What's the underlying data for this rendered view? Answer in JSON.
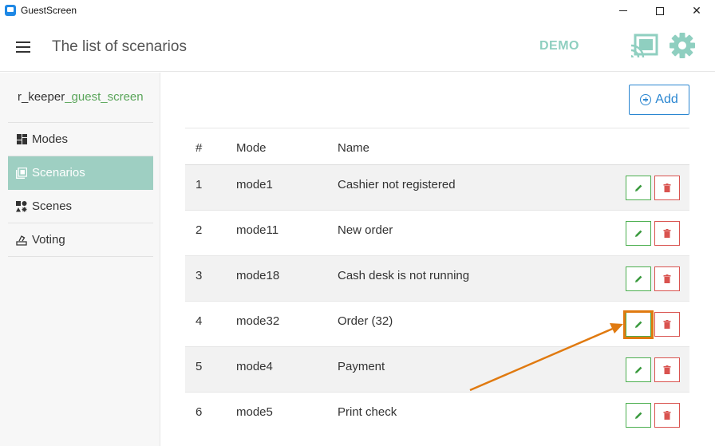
{
  "window": {
    "title": "GuestScreen",
    "minimize": "minimize",
    "maximize": "maximize",
    "close": "✕"
  },
  "header": {
    "page_title": "The list of scenarios",
    "demo_label": "DEMO",
    "icons": {
      "menu": "hamburger-icon",
      "cast": "cast-icon",
      "settings": "gear-icon"
    },
    "accent_color": "#8fcfc0"
  },
  "sidebar": {
    "brand_prefix": "r_keeper",
    "brand_suffix": "_guest_screen",
    "items": [
      {
        "label": "Modes",
        "icon": "dashboard-icon",
        "active": false
      },
      {
        "label": "Scenarios",
        "icon": "scenarios-icon",
        "active": true
      },
      {
        "label": "Scenes",
        "icon": "scenes-icon",
        "active": false
      },
      {
        "label": "Voting",
        "icon": "voting-icon",
        "active": false
      }
    ],
    "active_color": "#9ecfc2"
  },
  "toolbar": {
    "add_label": "Add"
  },
  "table": {
    "columns": [
      "#",
      "Mode",
      "Name"
    ],
    "rows": [
      {
        "num": "1",
        "mode": "mode1",
        "name": "Cashier not registered"
      },
      {
        "num": "2",
        "mode": "mode11",
        "name": "New order"
      },
      {
        "num": "3",
        "mode": "mode18",
        "name": "Cash desk is not running"
      },
      {
        "num": "4",
        "mode": "mode32",
        "name": "Order (32)"
      },
      {
        "num": "5",
        "mode": "mode4",
        "name": "Payment"
      },
      {
        "num": "6",
        "mode": "mode5",
        "name": "Print check"
      }
    ],
    "edit_color": "#4caf50",
    "delete_color": "#d9534f"
  },
  "annotation": {
    "color": "#e07a10"
  }
}
